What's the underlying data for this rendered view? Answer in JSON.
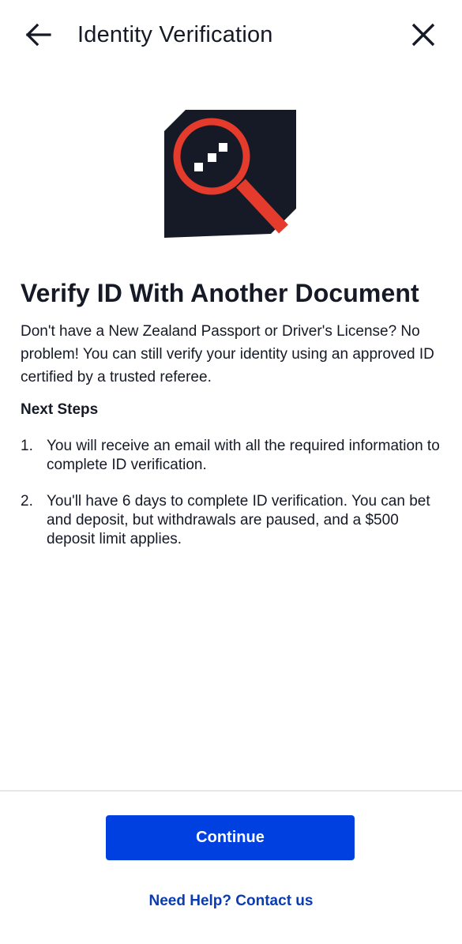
{
  "header": {
    "back_icon": "arrow-left-icon",
    "title": "Identity Verification",
    "close_icon": "close-icon"
  },
  "illustration": {
    "icon": "magnifier-document-icon",
    "colors": {
      "document": "#161a26",
      "lens": "#e53b2c",
      "dots": "#ffffff"
    }
  },
  "content": {
    "title": "Verify ID With Another Document",
    "intro": "Don't have a New Zealand Passport or Driver's License? No problem! You can still verify your identity using an approved ID certified by a trusted referee.",
    "next_steps_heading": "Next Steps",
    "steps": [
      {
        "number": "1.",
        "text": "You will receive an email with all the required information to complete ID verification."
      },
      {
        "number": "2.",
        "text": "You'll have 6 days to complete ID verification. You can bet and deposit, but withdrawals are paused, and a $500 deposit limit applies."
      }
    ]
  },
  "footer": {
    "continue_label": "Continue",
    "help_label": "Need Help? Contact us"
  },
  "colors": {
    "primary": "#0040e0",
    "link": "#0a3bb0",
    "text": "#161a26"
  }
}
